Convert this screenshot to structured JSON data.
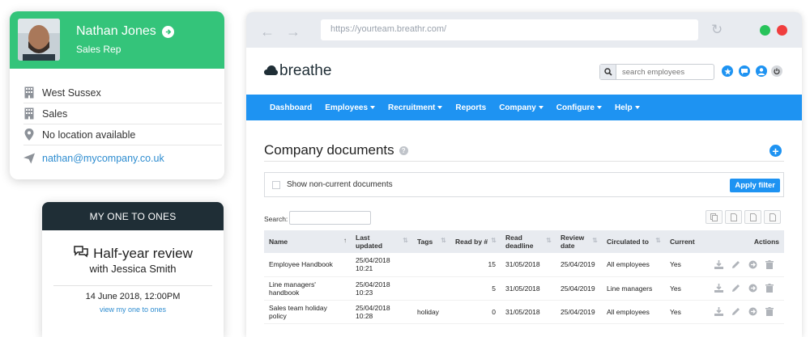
{
  "profile": {
    "name": "Nathan Jones",
    "role": "Sales Rep",
    "details": [
      {
        "icon": "building-icon",
        "text": "West Sussex"
      },
      {
        "icon": "building-icon",
        "text": "Sales"
      },
      {
        "icon": "location-pin-icon",
        "text": "No location available"
      },
      {
        "icon": "send-icon",
        "text": "nathan@mycompany.co.uk"
      }
    ]
  },
  "one_to_ones": {
    "header": "MY ONE TO ONES",
    "title": "Half-year review",
    "with": "with Jessica Smith",
    "date": "14 June 2018, 12:00PM",
    "link": "view my one to ones"
  },
  "browser": {
    "url": "https://yourteam.breathr.com/",
    "logo": "breathe",
    "search_placeholder": "search employees",
    "menu": [
      {
        "label": "Dashboard",
        "dropdown": false
      },
      {
        "label": "Employees",
        "dropdown": true
      },
      {
        "label": "Recruitment",
        "dropdown": true
      },
      {
        "label": "Reports",
        "dropdown": false
      },
      {
        "label": "Company",
        "dropdown": true
      },
      {
        "label": "Configure",
        "dropdown": true
      },
      {
        "label": "Help",
        "dropdown": true
      }
    ]
  },
  "documents": {
    "title": "Company documents",
    "filter_label": "Show non-current documents",
    "apply_label": "Apply filter",
    "search_label": "Search:",
    "columns": {
      "name": "Name",
      "last_updated_1": "Last",
      "last_updated_2": "updated",
      "tags": "Tags",
      "read_by": "Read by #",
      "read_deadline_1": "Read",
      "read_deadline_2": "deadline",
      "review_date_1": "Review",
      "review_date_2": "date",
      "circulated_to": "Circulated to",
      "current": "Current",
      "actions": "Actions"
    },
    "rows": [
      {
        "name": "Employee Handbook",
        "updated": "25/04/2018 10:21",
        "tags": "",
        "read_by": "15",
        "deadline": "31/05/2018",
        "review": "25/04/2019",
        "circulated": "All employees",
        "current": "Yes"
      },
      {
        "name": "Line managers' handbook",
        "updated": "25/04/2018 10:23",
        "tags": "",
        "read_by": "5",
        "deadline": "31/05/2018",
        "review": "25/04/2019",
        "circulated": "Line managers",
        "current": "Yes"
      },
      {
        "name": "Sales team holiday policy",
        "updated": "25/04/2018 10:28",
        "tags": "holiday",
        "read_by": "0",
        "deadline": "31/05/2018",
        "review": "25/04/2019",
        "circulated": "All employees",
        "current": "Yes"
      }
    ]
  },
  "colors": {
    "green": "#34c47a",
    "navy": "#1f2e36",
    "blue": "#1e93f2",
    "link": "#2d8cd0",
    "traffic_green": "#27c35a",
    "traffic_red": "#f03e3e"
  }
}
